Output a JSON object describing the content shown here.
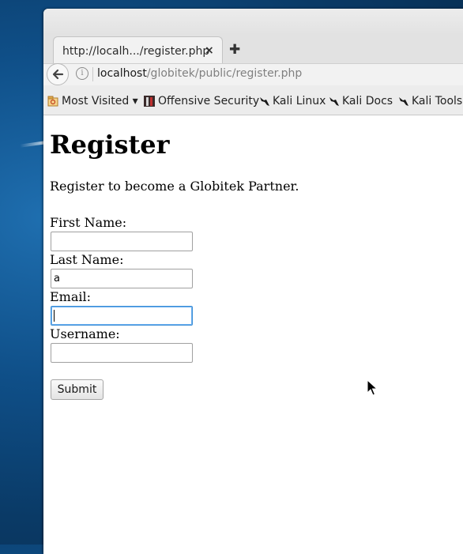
{
  "browser": {
    "tab": {
      "title": "http://localh.../register.php",
      "close": "×"
    },
    "new_tab": "✚",
    "address": {
      "host": "localhost",
      "path": "/globitek/public/register.php"
    },
    "bookmarks": [
      {
        "label": "Most Visited ▾",
        "icon": "most-visited-icon"
      },
      {
        "label": "Offensive Security",
        "icon": "offensive-security-icon"
      },
      {
        "label": "Kali Linux",
        "icon": "kali-dragon-icon"
      },
      {
        "label": "Kali Docs",
        "icon": "kali-dragon-icon"
      },
      {
        "label": "Kali Tools",
        "icon": "kali-dragon-icon"
      }
    ]
  },
  "page": {
    "title": "Register",
    "intro": "Register to become a Globitek Partner.",
    "form": {
      "first_name": {
        "label": "First Name:",
        "value": ""
      },
      "last_name": {
        "label": "Last Name:",
        "value": "a"
      },
      "email": {
        "label": "Email:",
        "value": ""
      },
      "username": {
        "label": "Username:",
        "value": ""
      },
      "submit": "Submit"
    }
  }
}
